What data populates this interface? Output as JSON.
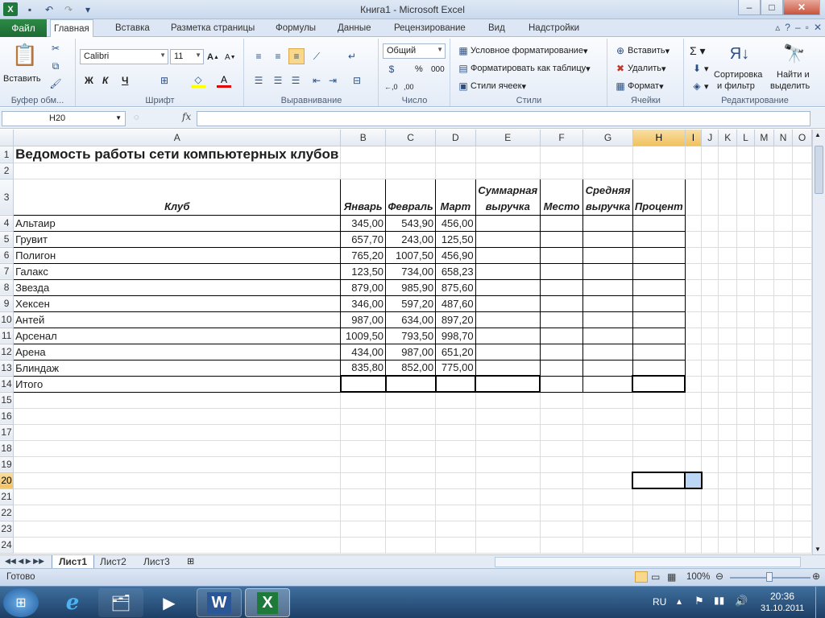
{
  "window": {
    "title": "Книга1 - Microsoft Excel",
    "minimize": "–",
    "maximize": "□",
    "close": "✕"
  },
  "ribbon_tabs": {
    "file": "Файл",
    "items": [
      "Главная",
      "Вставка",
      "Разметка страницы",
      "Формулы",
      "Данные",
      "Рецензирование",
      "Вид",
      "Надстройки"
    ]
  },
  "clipboard": {
    "paste": "Вставить",
    "label": "Буфер обм..."
  },
  "font": {
    "name": "Calibri",
    "size": "11",
    "bold": "Ж",
    "italic": "К",
    "underline": "Ч",
    "label": "Шрифт"
  },
  "alignment": {
    "label": "Выравнивание"
  },
  "number": {
    "format": "Общий",
    "percent": "%",
    "thousands": "000",
    "label": "Число"
  },
  "styles": {
    "conditional": "Условное форматирование",
    "as_table": "Форматировать как таблицу",
    "cell_styles": "Стили ячеек",
    "label": "Стили"
  },
  "cells": {
    "insert": "Вставить",
    "delete": "Удалить",
    "format": "Формат",
    "label": "Ячейки"
  },
  "editing": {
    "sort": "Сортировка\nи фильтр",
    "sort1": "Сортировка",
    "sort2": "и фильтр",
    "find1": "Найти и",
    "find2": "выделить",
    "label": "Редактирование"
  },
  "formula_bar": {
    "name_box": "H20",
    "fx": "fx",
    "value": ""
  },
  "columns": [
    "A",
    "B",
    "C",
    "D",
    "E",
    "F",
    "G",
    "H",
    "I",
    "J",
    "K",
    "L",
    "M",
    "N",
    "O"
  ],
  "sheet": {
    "title": "Ведомость работы сети компьютерных клубов",
    "headers": [
      "Клуб",
      "Январь",
      "Февраль",
      "Март",
      "Суммарная выручка",
      "Место",
      "Средняя выручка",
      "Процент"
    ],
    "header_lines": {
      "e1": "Суммарная",
      "e2": "выручка",
      "g1": "Средняя",
      "g2": "выручка"
    },
    "rows": [
      {
        "club": "Альтаир",
        "jan": "345,00",
        "feb": "543,90",
        "mar": "456,00"
      },
      {
        "club": "Грувит",
        "jan": "657,70",
        "feb": "243,00",
        "mar": "125,50"
      },
      {
        "club": "Полигон",
        "jan": "765,20",
        "feb": "1007,50",
        "mar": "456,90"
      },
      {
        "club": "Галакс",
        "jan": "123,50",
        "feb": "734,00",
        "mar": "658,23"
      },
      {
        "club": "Звезда",
        "jan": "879,00",
        "feb": "985,90",
        "mar": "875,60"
      },
      {
        "club": "Хексен",
        "jan": "346,00",
        "feb": "597,20",
        "mar": "487,60"
      },
      {
        "club": "Антей",
        "jan": "987,00",
        "feb": "634,00",
        "mar": "897,20"
      },
      {
        "club": "Арсенал",
        "jan": "1009,50",
        "feb": "793,50",
        "mar": "998,70"
      },
      {
        "club": "Арена",
        "jan": "434,00",
        "feb": "987,00",
        "mar": "651,20"
      },
      {
        "club": "Блиндаж",
        "jan": "835,80",
        "feb": "852,00",
        "mar": "775,00"
      }
    ],
    "total_label": "Итого"
  },
  "sheet_tabs": [
    "Лист1",
    "Лист2",
    "Лист3"
  ],
  "status": {
    "ready": "Готово",
    "zoom": "100%"
  },
  "taskbar": {
    "lang": "RU",
    "time": "20:36",
    "date": "31.10.2011"
  }
}
